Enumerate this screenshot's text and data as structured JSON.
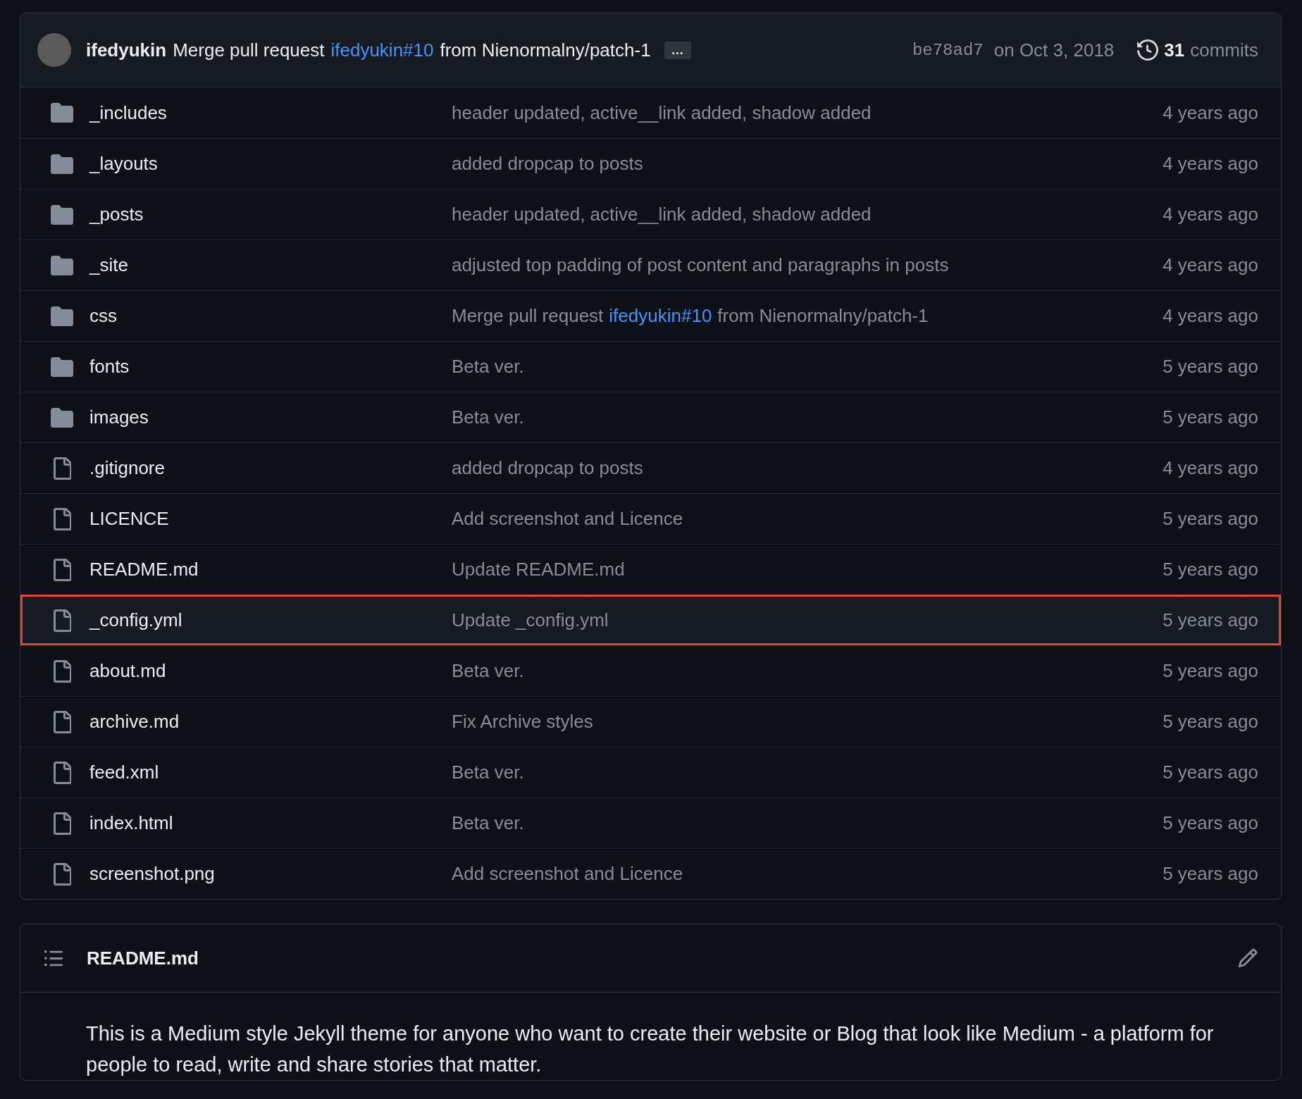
{
  "latest_commit": {
    "author": "ifedyukin",
    "message": [
      {
        "kind": "text",
        "text": "Merge pull request"
      },
      {
        "kind": "link",
        "text": "ifedyukin#10"
      },
      {
        "kind": "text",
        "text": "from Nienormalny/patch-1"
      }
    ],
    "more_label": "…",
    "sha": "be78ad7",
    "date": "on Oct 3, 2018",
    "commit_count": "31",
    "commit_label": "commits"
  },
  "files": [
    {
      "kind": "folder",
      "name": "_includes",
      "message": [
        {
          "kind": "text",
          "text": "header updated, active__link added, shadow added"
        }
      ],
      "age": "4 years ago",
      "highlighted": false
    },
    {
      "kind": "folder",
      "name": "_layouts",
      "message": [
        {
          "kind": "text",
          "text": "added dropcap to posts"
        }
      ],
      "age": "4 years ago",
      "highlighted": false
    },
    {
      "kind": "folder",
      "name": "_posts",
      "message": [
        {
          "kind": "text",
          "text": "header updated, active__link added, shadow added"
        }
      ],
      "age": "4 years ago",
      "highlighted": false
    },
    {
      "kind": "folder",
      "name": "_site",
      "message": [
        {
          "kind": "text",
          "text": "adjusted top padding of post content and paragraphs in posts"
        }
      ],
      "age": "4 years ago",
      "highlighted": false
    },
    {
      "kind": "folder",
      "name": "css",
      "message": [
        {
          "kind": "text",
          "text": "Merge pull request"
        },
        {
          "kind": "link",
          "text": "ifedyukin#10"
        },
        {
          "kind": "text",
          "text": "from Nienormalny/patch-1"
        }
      ],
      "age": "4 years ago",
      "highlighted": false
    },
    {
      "kind": "folder",
      "name": "fonts",
      "message": [
        {
          "kind": "text",
          "text": "Beta ver."
        }
      ],
      "age": "5 years ago",
      "highlighted": false
    },
    {
      "kind": "folder",
      "name": "images",
      "message": [
        {
          "kind": "text",
          "text": "Beta ver."
        }
      ],
      "age": "5 years ago",
      "highlighted": false
    },
    {
      "kind": "file",
      "name": ".gitignore",
      "message": [
        {
          "kind": "text",
          "text": "added dropcap to posts"
        }
      ],
      "age": "4 years ago",
      "highlighted": false
    },
    {
      "kind": "file",
      "name": "LICENCE",
      "message": [
        {
          "kind": "text",
          "text": "Add screenshot and Licence"
        }
      ],
      "age": "5 years ago",
      "highlighted": false
    },
    {
      "kind": "file",
      "name": "README.md",
      "message": [
        {
          "kind": "text",
          "text": "Update README.md"
        }
      ],
      "age": "5 years ago",
      "highlighted": false
    },
    {
      "kind": "file",
      "name": "_config.yml",
      "message": [
        {
          "kind": "text",
          "text": "Update _config.yml"
        }
      ],
      "age": "5 years ago",
      "highlighted": true
    },
    {
      "kind": "file",
      "name": "about.md",
      "message": [
        {
          "kind": "text",
          "text": "Beta ver."
        }
      ],
      "age": "5 years ago",
      "highlighted": false
    },
    {
      "kind": "file",
      "name": "archive.md",
      "message": [
        {
          "kind": "text",
          "text": "Fix Archive styles"
        }
      ],
      "age": "5 years ago",
      "highlighted": false
    },
    {
      "kind": "file",
      "name": "feed.xml",
      "message": [
        {
          "kind": "text",
          "text": "Beta ver."
        }
      ],
      "age": "5 years ago",
      "highlighted": false
    },
    {
      "kind": "file",
      "name": "index.html",
      "message": [
        {
          "kind": "text",
          "text": "Beta ver."
        }
      ],
      "age": "5 years ago",
      "highlighted": false
    },
    {
      "kind": "file",
      "name": "screenshot.png",
      "message": [
        {
          "kind": "text",
          "text": "Add screenshot and Licence"
        }
      ],
      "age": "5 years ago",
      "highlighted": false
    }
  ],
  "readme": {
    "title": "README.md",
    "text": "This is a Medium style Jekyll theme for anyone who want to create their website or Blog that look like Medium - a platform for people to read, write and share stories that matter."
  }
}
